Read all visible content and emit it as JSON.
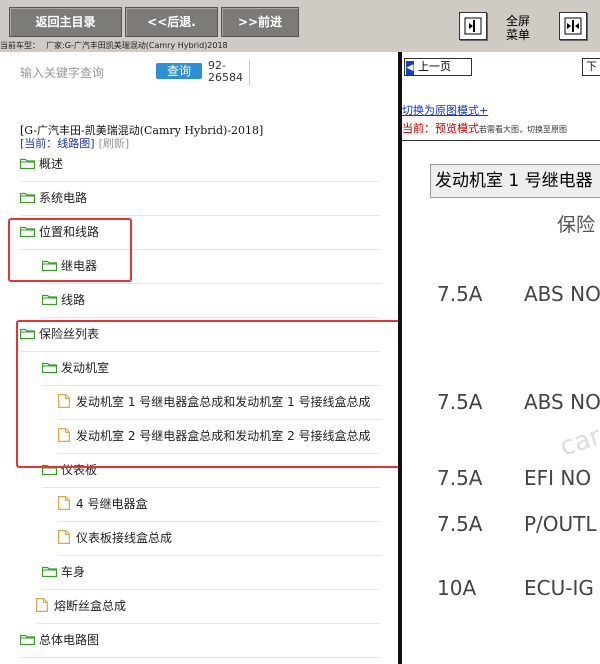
{
  "toolbar": {
    "home_label": "返回主目录",
    "back_label": "<<后退.",
    "forward_label": ">>前进",
    "fullscreen_label": "全屏\n菜单"
  },
  "header_info": {
    "current_vehicle": "当前车型：",
    "vendor": "厂家:G-广汽丰田凯美瑞混动(Camry Hybrid)2018"
  },
  "search": {
    "placeholder": "输入关键字查询",
    "button_label": "查询",
    "code": "92-\n26584"
  },
  "breadcrumb": {
    "vehicle": "[G-广汽丰田-凯美瑞混动(Camry Hybrid)-2018]",
    "current": "[当前：线路图]",
    "refresh": "[刷新]"
  },
  "tree": [
    {
      "label": "概述",
      "type": "folder"
    },
    {
      "label": "系统电路",
      "type": "folder"
    },
    {
      "label": "位置和线路",
      "type": "folder"
    },
    {
      "label": "继电器",
      "type": "folder"
    },
    {
      "label": "线路",
      "type": "folder"
    },
    {
      "label": "保险丝列表",
      "type": "folder"
    },
    {
      "label": "发动机室",
      "type": "folder"
    },
    {
      "label": "发动机室 1 号继电器盒总成和发动机室 1 号接线盒总成",
      "type": "doc"
    },
    {
      "label": "发动机室 2 号继电器盒总成和发动机室 2 号接线盒总成",
      "type": "doc"
    },
    {
      "label": "仪表板",
      "type": "folder"
    },
    {
      "label": "4 号继电器盒",
      "type": "doc"
    },
    {
      "label": "仪表板接线盒总成",
      "type": "doc"
    },
    {
      "label": "车身",
      "type": "folder"
    },
    {
      "label": "熔断丝盒总成",
      "type": "doc"
    },
    {
      "label": "总体电路图",
      "type": "folder"
    }
  ],
  "viewer": {
    "prev_label": "上一页",
    "next_label": "下",
    "switch_link": "切换为原图模式+",
    "mode_label": "当前：",
    "mode_value": "预览模式",
    "mode_tip": "若需看大图，切换至原图",
    "box_title": "发动机室 1 号继电器",
    "subtitle": "保险",
    "fuses": [
      {
        "amp": "7.5A",
        "name": "ABS NO"
      },
      {
        "amp": "7.5A",
        "name": "ABS NO"
      },
      {
        "amp": "7.5A",
        "name": "EFI NO"
      },
      {
        "amp": "7.5A",
        "name": "P/OUTL"
      },
      {
        "amp": "10A",
        "name": "ECU-IG"
      }
    ],
    "watermark": "car"
  },
  "colors": {
    "toolbar_bg": "#cfcac3",
    "button_bg": "#7d7b77",
    "highlight": "#e0343b",
    "search_button": "#2f8fd2",
    "folder_green": "#3a9a2a",
    "doc_orange": "#e4a64a",
    "link_blue": "#1133cc",
    "mode_red": "#cc0000"
  },
  "icons": {
    "folder": "folder-icon",
    "doc": "document-icon",
    "fullscreen": "fullscreen-icon",
    "split": "split-view-icon",
    "prev_arrow": "arrow-left-icon"
  }
}
